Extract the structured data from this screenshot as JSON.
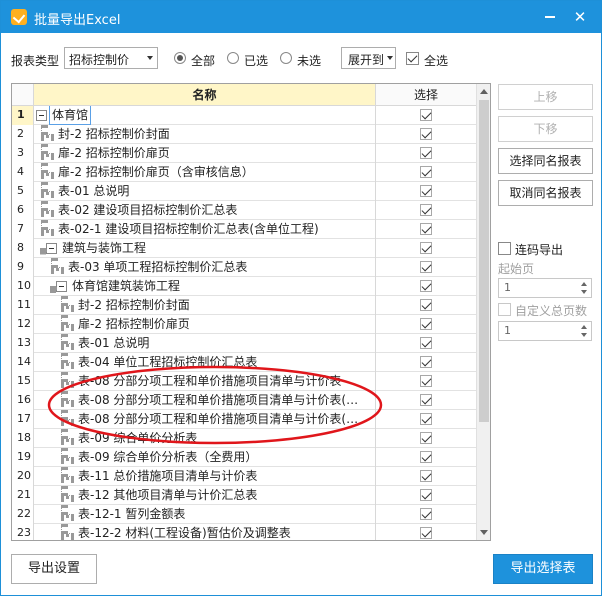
{
  "window": {
    "title": "批量导出Excel",
    "min_icon": "minimize-icon",
    "close_icon": "close-icon",
    "close_glyph": "✕"
  },
  "toolbar": {
    "report_type_label": "报表类型",
    "report_type_value": "招标控制价",
    "filter_all": "全部",
    "filter_selected": "已选",
    "filter_unselected": "未选",
    "filter_value": "全部",
    "expand_value": "展开到",
    "select_all_label": "全选",
    "select_all_checked": true
  },
  "grid": {
    "col_name": "名称",
    "col_select": "选择",
    "rows": [
      {
        "no": "1",
        "name": "体育馆",
        "checked": true
      },
      {
        "no": "2",
        "name": "封-2 招标控制价封面",
        "checked": true
      },
      {
        "no": "3",
        "name": "扉-2 招标控制价扉页",
        "checked": true
      },
      {
        "no": "4",
        "name": "扉-2 招标控制价扉页（含审核信息）",
        "checked": true
      },
      {
        "no": "5",
        "name": "表-01 总说明",
        "checked": true
      },
      {
        "no": "6",
        "name": "表-02 建设项目招标控制价汇总表",
        "checked": true
      },
      {
        "no": "7",
        "name": "表-02-1 建设项目招标控制价汇总表(含单位工程)",
        "checked": true
      },
      {
        "no": "8",
        "name": "建筑与装饰工程",
        "checked": true
      },
      {
        "no": "9",
        "name": "表-03 单项工程招标控制价汇总表",
        "checked": true
      },
      {
        "no": "10",
        "name": "体育馆建筑装饰工程",
        "checked": true
      },
      {
        "no": "11",
        "name": "封-2 招标控制价封面",
        "checked": true
      },
      {
        "no": "12",
        "name": "扉-2 招标控制价扉页",
        "checked": true
      },
      {
        "no": "13",
        "name": "表-01 总说明",
        "checked": true
      },
      {
        "no": "14",
        "name": "表-04 单位工程招标控制价汇总表",
        "checked": true
      },
      {
        "no": "15",
        "name": "表-08 分部分项工程和单价措施项目清单与计价表",
        "checked": true
      },
      {
        "no": "16",
        "name": "表-08 分部分项工程和单价措施项目清单与计价表(…",
        "checked": true
      },
      {
        "no": "17",
        "name": "表-08 分部分项工程和单价措施项目清单与计价表(…",
        "checked": true
      },
      {
        "no": "18",
        "name": "表-09 综合单价分析表",
        "checked": true
      },
      {
        "no": "19",
        "name": "表-09 综合单价分析表（全费用）",
        "checked": true
      },
      {
        "no": "20",
        "name": "表-11 总价措施项目清单与计价表",
        "checked": true
      },
      {
        "no": "21",
        "name": "表-12 其他项目清单与计价汇总表",
        "checked": true
      },
      {
        "no": "22",
        "name": "表-12-1 暂列金额表",
        "checked": true
      },
      {
        "no": "23",
        "name": "表-12-2 材料(工程设备)暂估价及调整表",
        "checked": true
      }
    ]
  },
  "side": {
    "move_up": "上移",
    "move_down": "下移",
    "select_same": "选择同名报表",
    "cancel_same": "取消同名报表",
    "continuous_export": "连码导出",
    "start_page": "起始页",
    "start_page_value": "1",
    "custom_total": "自定义总页数",
    "custom_total_value": "1"
  },
  "footer": {
    "export_settings": "导出设置",
    "export_selected": "导出选择表"
  },
  "colors": {
    "accent": "#1e92dc",
    "header_bg": "#fff6c8",
    "annotation": "#e0161b"
  }
}
